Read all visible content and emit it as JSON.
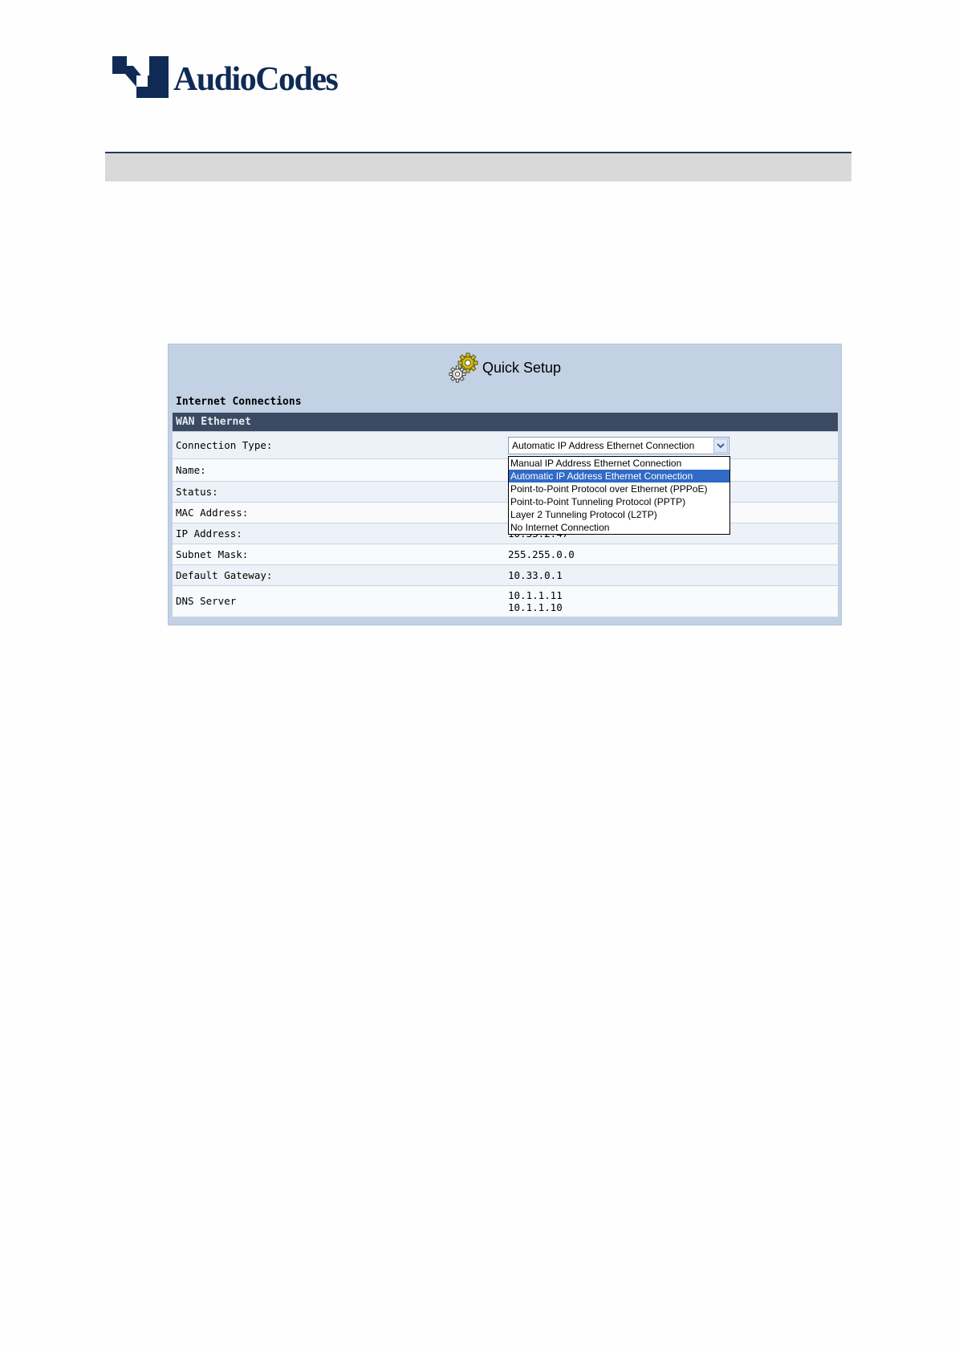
{
  "brand": {
    "name": "AudioCodes",
    "color": "#0f2a55"
  },
  "quick_setup": {
    "title": "Quick Setup",
    "icon": "gear-icon",
    "section_label": "Internet Connections",
    "group_header": "WAN Ethernet",
    "rows": [
      {
        "label": "Connection Type:",
        "value": ""
      },
      {
        "label": "Name:",
        "value": ""
      },
      {
        "label": "Status:",
        "value": ""
      },
      {
        "label": "MAC Address:",
        "value": ""
      },
      {
        "label": "IP Address:",
        "value": "10.33.2.47"
      },
      {
        "label": "Subnet Mask:",
        "value": "255.255.0.0"
      },
      {
        "label": "Default Gateway:",
        "value": "10.33.0.1"
      },
      {
        "label": "DNS Server",
        "value": "",
        "values": [
          "10.1.1.11",
          "10.1.1.10"
        ]
      }
    ],
    "connection_type": {
      "selected": "Automatic IP Address Ethernet Connection",
      "options": [
        "Manual IP Address Ethernet Connection",
        "Automatic IP Address Ethernet Connection",
        "Point-to-Point Protocol over Ethernet (PPPoE)",
        "Point-to-Point Tunneling Protocol (PPTP)",
        "Layer 2 Tunneling Protocol (L2TP)",
        "No Internet Connection"
      ],
      "highlighted_index": 1
    }
  },
  "colors": {
    "panel_bg": "#c2d1e3",
    "group_header_bg": "#3b4a60",
    "highlight": "#316ac5"
  }
}
